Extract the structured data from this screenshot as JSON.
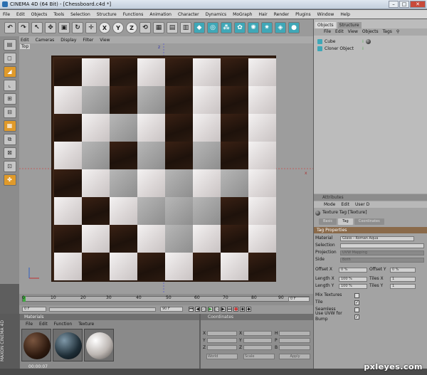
{
  "window": {
    "title": "CINEMA 4D (64 Bit) - [Chessboard.c4d *]",
    "min": "–",
    "max": "□",
    "close": "✕"
  },
  "menu": [
    "File",
    "Edit",
    "Objects",
    "Tools",
    "Selection",
    "Structure",
    "Functions",
    "Animation",
    "Character",
    "Dynamics",
    "MoGraph",
    "Hair",
    "Render",
    "Plugins",
    "Window",
    "Help"
  ],
  "toolbar": {
    "axis_x": "X",
    "axis_y": "Y",
    "axis_z": "Z"
  },
  "viewport": {
    "menu": [
      "Edit",
      "Cameras",
      "Display",
      "Filter",
      "View"
    ],
    "label": "Top",
    "axis_z": "z",
    "axis_x": "x"
  },
  "timeline": {
    "ticks": [
      "0",
      "10",
      "20",
      "30",
      "40",
      "50",
      "60",
      "70",
      "80",
      "90"
    ],
    "start": "0 F",
    "end_field": "0 F",
    "fps_field": "90 F",
    "frame_field": "0 F",
    "time": "00:00:07"
  },
  "materials": {
    "header": "Materials",
    "menu": [
      "File",
      "Edit",
      "Function",
      "Texture"
    ]
  },
  "coordinates": {
    "header": "Coordinates",
    "world": "World",
    "scale": "Scale",
    "apply": "Apply",
    "labels": [
      "X",
      "Y",
      "Z"
    ],
    "labels2": [
      "X",
      "Y",
      "Z"
    ],
    "labels3": [
      "H",
      "P",
      "B"
    ]
  },
  "objects": {
    "tabs": [
      "Objects",
      "Structure"
    ],
    "menu": [
      "File",
      "Edit",
      "View",
      "Objects",
      "Tags"
    ],
    "items": [
      "Cube",
      "Cloner Object"
    ]
  },
  "attributes": {
    "header": "Attributes",
    "menu": [
      "Mode",
      "Edit",
      "User D"
    ],
    "title": "Texture Tag [Texture]",
    "subtabs": [
      "Basic",
      "Tag",
      "Coordinates"
    ],
    "section": "Tag Properties",
    "material_label": "Material",
    "material_value": "Glass - Roman Aqua",
    "selection_label": "Selection",
    "projection_label": "Projection",
    "projection_value": "UVW Mapping",
    "side_label": "Side",
    "side_value": "Both",
    "offset_x": "Offset X",
    "offset_x_val": "0 %",
    "offset_y": "Offset Y",
    "offset_y_val": "0 %",
    "length_x": "Length X",
    "length_x_val": "100 %",
    "tiles_x": "Tiles X",
    "tiles_x_val": "1",
    "length_y": "Length Y",
    "length_y_val": "100 %",
    "tiles_y": "Tiles Y",
    "tiles_y_val": "1",
    "mix": "Mix Textures",
    "tile": "Tile",
    "seamless": "Seamless",
    "uvw": "Use UVW for Bump"
  },
  "brand": {
    "maxon": "MAXON CINEMA 4D"
  },
  "watermark": "pxleyes.com"
}
